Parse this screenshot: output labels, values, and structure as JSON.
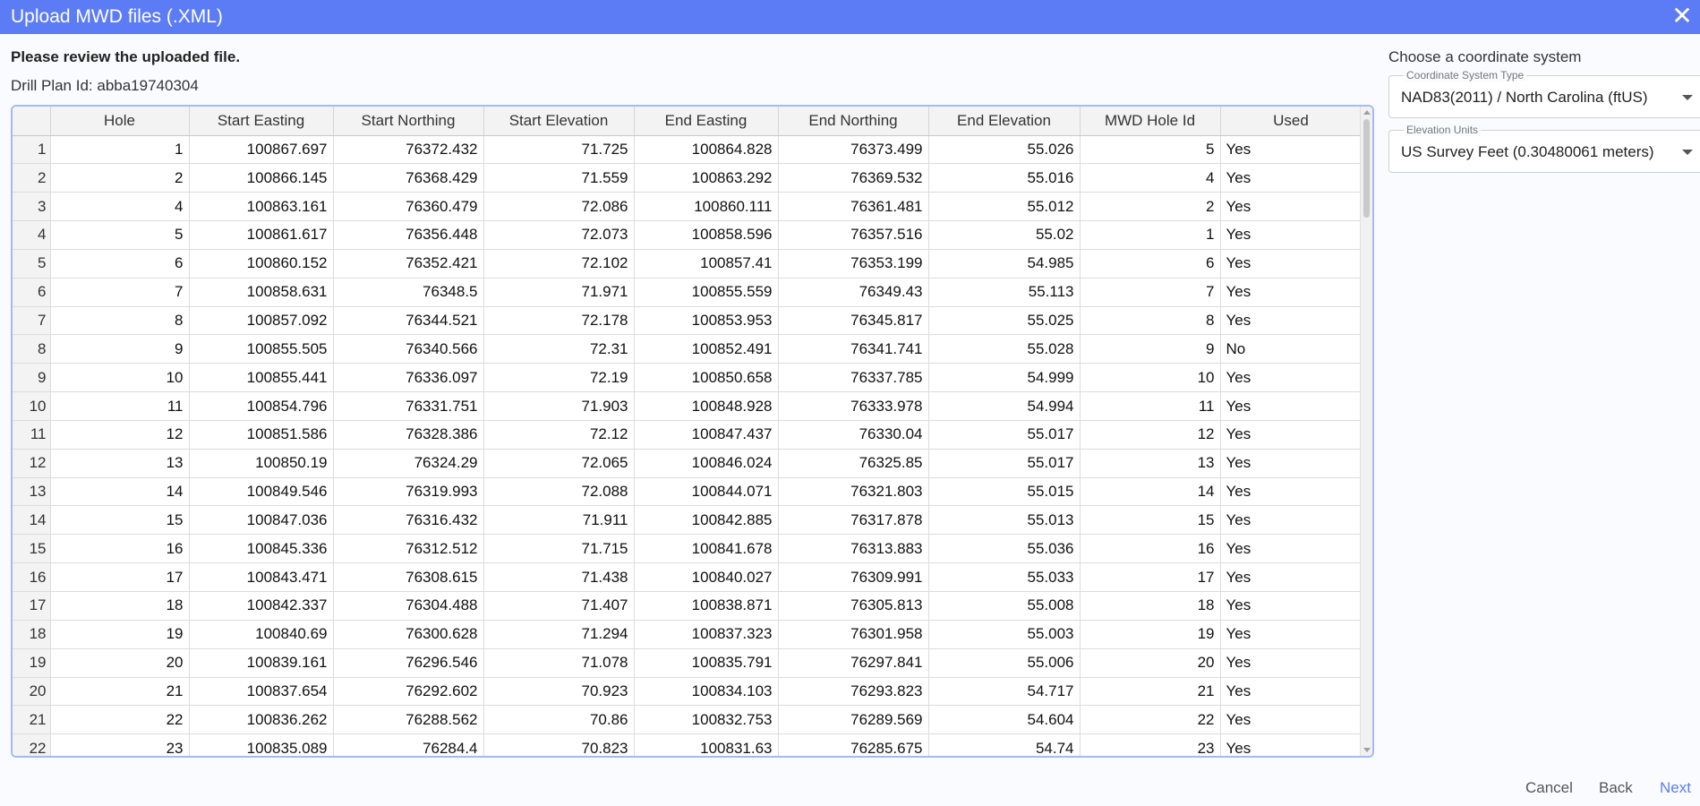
{
  "dialog": {
    "title": "Upload MWD files (.XML)",
    "close_icon": "✕"
  },
  "review": {
    "instruction": "Please review the uploaded file.",
    "plan_id_text": "Drill Plan Id: abba19740304"
  },
  "table": {
    "columns": [
      "Hole",
      "Start Easting",
      "Start Northing",
      "Start Elevation",
      "End Easting",
      "End Northing",
      "End Elevation",
      "MWD Hole Id",
      "Used"
    ],
    "rows": [
      [
        "1",
        "1",
        "100867.697",
        "76372.432",
        "71.725",
        "100864.828",
        "76373.499",
        "55.026",
        "5",
        "Yes"
      ],
      [
        "2",
        "2",
        "100866.145",
        "76368.429",
        "71.559",
        "100863.292",
        "76369.532",
        "55.016",
        "4",
        "Yes"
      ],
      [
        "3",
        "4",
        "100863.161",
        "76360.479",
        "72.086",
        "100860.111",
        "76361.481",
        "55.012",
        "2",
        "Yes"
      ],
      [
        "4",
        "5",
        "100861.617",
        "76356.448",
        "72.073",
        "100858.596",
        "76357.516",
        "55.02",
        "1",
        "Yes"
      ],
      [
        "5",
        "6",
        "100860.152",
        "76352.421",
        "72.102",
        "100857.41",
        "76353.199",
        "54.985",
        "6",
        "Yes"
      ],
      [
        "6",
        "7",
        "100858.631",
        "76348.5",
        "71.971",
        "100855.559",
        "76349.43",
        "55.113",
        "7",
        "Yes"
      ],
      [
        "7",
        "8",
        "100857.092",
        "76344.521",
        "72.178",
        "100853.953",
        "76345.817",
        "55.025",
        "8",
        "Yes"
      ],
      [
        "8",
        "9",
        "100855.505",
        "76340.566",
        "72.31",
        "100852.491",
        "76341.741",
        "55.028",
        "9",
        "No"
      ],
      [
        "9",
        "10",
        "100855.441",
        "76336.097",
        "72.19",
        "100850.658",
        "76337.785",
        "54.999",
        "10",
        "Yes"
      ],
      [
        "10",
        "11",
        "100854.796",
        "76331.751",
        "71.903",
        "100848.928",
        "76333.978",
        "54.994",
        "11",
        "Yes"
      ],
      [
        "11",
        "12",
        "100851.586",
        "76328.386",
        "72.12",
        "100847.437",
        "76330.04",
        "55.017",
        "12",
        "Yes"
      ],
      [
        "12",
        "13",
        "100850.19",
        "76324.29",
        "72.065",
        "100846.024",
        "76325.85",
        "55.017",
        "13",
        "Yes"
      ],
      [
        "13",
        "14",
        "100849.546",
        "76319.993",
        "72.088",
        "100844.071",
        "76321.803",
        "55.015",
        "14",
        "Yes"
      ],
      [
        "14",
        "15",
        "100847.036",
        "76316.432",
        "71.911",
        "100842.885",
        "76317.878",
        "55.013",
        "15",
        "Yes"
      ],
      [
        "15",
        "16",
        "100845.336",
        "76312.512",
        "71.715",
        "100841.678",
        "76313.883",
        "55.036",
        "16",
        "Yes"
      ],
      [
        "16",
        "17",
        "100843.471",
        "76308.615",
        "71.438",
        "100840.027",
        "76309.991",
        "55.033",
        "17",
        "Yes"
      ],
      [
        "17",
        "18",
        "100842.337",
        "76304.488",
        "71.407",
        "100838.871",
        "76305.813",
        "55.008",
        "18",
        "Yes"
      ],
      [
        "18",
        "19",
        "100840.69",
        "76300.628",
        "71.294",
        "100837.323",
        "76301.958",
        "55.003",
        "19",
        "Yes"
      ],
      [
        "19",
        "20",
        "100839.161",
        "76296.546",
        "71.078",
        "100835.791",
        "76297.841",
        "55.006",
        "20",
        "Yes"
      ],
      [
        "20",
        "21",
        "100837.654",
        "76292.602",
        "70.923",
        "100834.103",
        "76293.823",
        "54.717",
        "21",
        "Yes"
      ],
      [
        "21",
        "22",
        "100836.262",
        "76288.562",
        "70.86",
        "100832.753",
        "76289.569",
        "54.604",
        "22",
        "Yes"
      ],
      [
        "22",
        "23",
        "100835.089",
        "76284.4",
        "70.823",
        "100831.63",
        "76285.675",
        "54.74",
        "23",
        "Yes"
      ]
    ]
  },
  "coordinate": {
    "heading": "Choose a coordinate system",
    "system_type_label": "Coordinate System Type",
    "system_type_value": "NAD83(2011) / North Carolina (ftUS)",
    "elevation_label": "Elevation Units",
    "elevation_value": "US Survey Feet (0.30480061 meters)"
  },
  "footer": {
    "cancel": "Cancel",
    "back": "Back",
    "next": "Next"
  },
  "colors": {
    "accent": "#5b7cf5",
    "grid_border": "#a9b8f3",
    "header_bg": "#f3f3f3"
  }
}
